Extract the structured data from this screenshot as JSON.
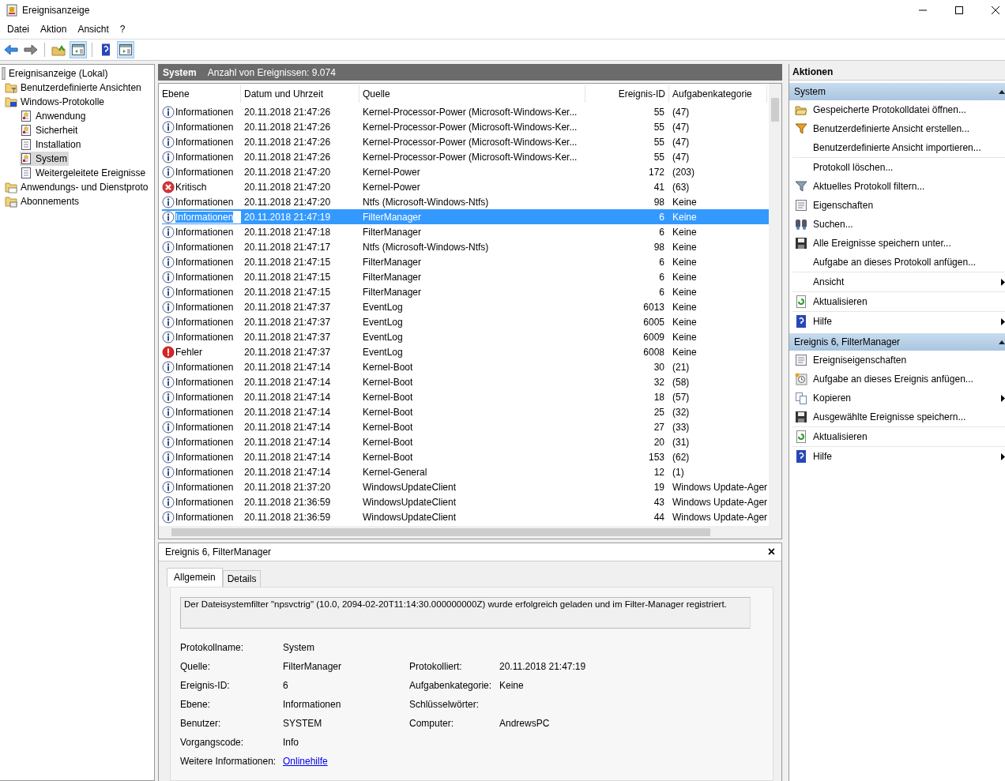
{
  "window": {
    "title": "Ereignisanzeige"
  },
  "menu": [
    "Datei",
    "Aktion",
    "Ansicht",
    "?"
  ],
  "toolbar": [
    {
      "kind": "back",
      "pressed": false
    },
    {
      "kind": "forward",
      "pressed": false
    },
    {
      "kind": "sep"
    },
    {
      "kind": "folder-up",
      "pressed": false
    },
    {
      "kind": "pane-left",
      "pressed": true
    },
    {
      "kind": "sep"
    },
    {
      "kind": "help",
      "pressed": false
    },
    {
      "kind": "pane-right",
      "pressed": true
    }
  ],
  "tree": [
    {
      "label": "Ereignisanzeige (Lokal)",
      "kind": "root",
      "selected": false,
      "children": [
        {
          "label": "Benutzerdefinierte Ansichten",
          "kind": "folder-filter",
          "selected": false
        },
        {
          "label": "Windows-Protokolle",
          "kind": "folder-windows",
          "selected": false,
          "children": [
            {
              "label": "Anwendung",
              "kind": "log",
              "selected": false
            },
            {
              "label": "Sicherheit",
              "kind": "log",
              "selected": false
            },
            {
              "label": "Installation",
              "kind": "log-plain",
              "selected": false
            },
            {
              "label": "System",
              "kind": "log",
              "selected": true
            },
            {
              "label": "Weitergeleitete Ereignisse",
              "kind": "log-plain",
              "selected": false
            }
          ]
        },
        {
          "label": "Anwendungs- und Dienstproto",
          "kind": "folder",
          "selected": false
        },
        {
          "label": "Abonnements",
          "kind": "folder-sub",
          "selected": false
        }
      ]
    }
  ],
  "log_header": {
    "name": "System",
    "count": "Anzahl von Ereignissen: 9.074"
  },
  "table": {
    "columns": [
      "Ebene",
      "Datum und Uhrzeit",
      "Quelle",
      "Ereignis-ID",
      "Aufgabenkategorie"
    ],
    "rows": [
      {
        "kind": "info",
        "level": "Informationen",
        "date": "20.11.2018 21:47:26",
        "source": "Kernel-Processor-Power (Microsoft-Windows-Ker...",
        "id": "55",
        "category": "(47)",
        "selected": false
      },
      {
        "kind": "info",
        "level": "Informationen",
        "date": "20.11.2018 21:47:26",
        "source": "Kernel-Processor-Power (Microsoft-Windows-Ker...",
        "id": "55",
        "category": "(47)",
        "selected": false
      },
      {
        "kind": "info",
        "level": "Informationen",
        "date": "20.11.2018 21:47:26",
        "source": "Kernel-Processor-Power (Microsoft-Windows-Ker...",
        "id": "55",
        "category": "(47)",
        "selected": false
      },
      {
        "kind": "info",
        "level": "Informationen",
        "date": "20.11.2018 21:47:26",
        "source": "Kernel-Processor-Power (Microsoft-Windows-Ker...",
        "id": "55",
        "category": "(47)",
        "selected": false
      },
      {
        "kind": "info",
        "level": "Informationen",
        "date": "20.11.2018 21:47:20",
        "source": "Kernel-Power",
        "id": "172",
        "category": "(203)",
        "selected": false
      },
      {
        "kind": "critical",
        "level": "Kritisch",
        "date": "20.11.2018 21:47:20",
        "source": "Kernel-Power",
        "id": "41",
        "category": "(63)",
        "selected": false
      },
      {
        "kind": "info",
        "level": "Informationen",
        "date": "20.11.2018 21:47:20",
        "source": "Ntfs (Microsoft-Windows-Ntfs)",
        "id": "98",
        "category": "Keine",
        "selected": false
      },
      {
        "kind": "info",
        "level": "Informationen",
        "date": "20.11.2018 21:47:19",
        "source": "FilterManager",
        "id": "6",
        "category": "Keine",
        "selected": true
      },
      {
        "kind": "info",
        "level": "Informationen",
        "date": "20.11.2018 21:47:18",
        "source": "FilterManager",
        "id": "6",
        "category": "Keine",
        "selected": false
      },
      {
        "kind": "info",
        "level": "Informationen",
        "date": "20.11.2018 21:47:17",
        "source": "Ntfs (Microsoft-Windows-Ntfs)",
        "id": "98",
        "category": "Keine",
        "selected": false
      },
      {
        "kind": "info",
        "level": "Informationen",
        "date": "20.11.2018 21:47:15",
        "source": "FilterManager",
        "id": "6",
        "category": "Keine",
        "selected": false
      },
      {
        "kind": "info",
        "level": "Informationen",
        "date": "20.11.2018 21:47:15",
        "source": "FilterManager",
        "id": "6",
        "category": "Keine",
        "selected": false
      },
      {
        "kind": "info",
        "level": "Informationen",
        "date": "20.11.2018 21:47:15",
        "source": "FilterManager",
        "id": "6",
        "category": "Keine",
        "selected": false
      },
      {
        "kind": "info",
        "level": "Informationen",
        "date": "20.11.2018 21:47:37",
        "source": "EventLog",
        "id": "6013",
        "category": "Keine",
        "selected": false
      },
      {
        "kind": "info",
        "level": "Informationen",
        "date": "20.11.2018 21:47:37",
        "source": "EventLog",
        "id": "6005",
        "category": "Keine",
        "selected": false
      },
      {
        "kind": "info",
        "level": "Informationen",
        "date": "20.11.2018 21:47:37",
        "source": "EventLog",
        "id": "6009",
        "category": "Keine",
        "selected": false
      },
      {
        "kind": "error",
        "level": "Fehler",
        "date": "20.11.2018 21:47:37",
        "source": "EventLog",
        "id": "6008",
        "category": "Keine",
        "selected": false
      },
      {
        "kind": "info",
        "level": "Informationen",
        "date": "20.11.2018 21:47:14",
        "source": "Kernel-Boot",
        "id": "30",
        "category": "(21)",
        "selected": false
      },
      {
        "kind": "info",
        "level": "Informationen",
        "date": "20.11.2018 21:47:14",
        "source": "Kernel-Boot",
        "id": "32",
        "category": "(58)",
        "selected": false
      },
      {
        "kind": "info",
        "level": "Informationen",
        "date": "20.11.2018 21:47:14",
        "source": "Kernel-Boot",
        "id": "18",
        "category": "(57)",
        "selected": false
      },
      {
        "kind": "info",
        "level": "Informationen",
        "date": "20.11.2018 21:47:14",
        "source": "Kernel-Boot",
        "id": "25",
        "category": "(32)",
        "selected": false
      },
      {
        "kind": "info",
        "level": "Informationen",
        "date": "20.11.2018 21:47:14",
        "source": "Kernel-Boot",
        "id": "27",
        "category": "(33)",
        "selected": false
      },
      {
        "kind": "info",
        "level": "Informationen",
        "date": "20.11.2018 21:47:14",
        "source": "Kernel-Boot",
        "id": "20",
        "category": "(31)",
        "selected": false
      },
      {
        "kind": "info",
        "level": "Informationen",
        "date": "20.11.2018 21:47:14",
        "source": "Kernel-Boot",
        "id": "153",
        "category": "(62)",
        "selected": false
      },
      {
        "kind": "info",
        "level": "Informationen",
        "date": "20.11.2018 21:47:14",
        "source": "Kernel-General",
        "id": "12",
        "category": "(1)",
        "selected": false
      },
      {
        "kind": "info",
        "level": "Informationen",
        "date": "20.11.2018 21:37:20",
        "source": "WindowsUpdateClient",
        "id": "19",
        "category": "Windows Update-Ager",
        "selected": false
      },
      {
        "kind": "info",
        "level": "Informationen",
        "date": "20.11.2018 21:36:59",
        "source": "WindowsUpdateClient",
        "id": "43",
        "category": "Windows Update-Ager",
        "selected": false
      },
      {
        "kind": "info",
        "level": "Informationen",
        "date": "20.11.2018 21:36:59",
        "source": "WindowsUpdateClient",
        "id": "44",
        "category": "Windows Update-Ager",
        "selected": false
      }
    ]
  },
  "detail": {
    "title": "Ereignis 6, FilterManager",
    "close": "×",
    "tabs": [
      {
        "label": "Allgemein",
        "selected": true
      },
      {
        "label": "Details",
        "selected": false
      }
    ],
    "message": "Der Dateisystemfilter \"npsvctrig\" (10.0, 2094-02-20T11:14:30.000000000Z) wurde erfolgreich geladen und im Filter-Manager registriert.",
    "fields": [
      [
        {
          "label": "Protokollname:",
          "value": "System"
        }
      ],
      [
        {
          "label": "Quelle:",
          "value": "FilterManager"
        },
        {
          "label": "Protokolliert:",
          "value": "20.11.2018 21:47:19"
        }
      ],
      [
        {
          "label": "Ereignis-ID:",
          "value": "6"
        },
        {
          "label": "Aufgabenkategorie:",
          "value": "Keine"
        }
      ],
      [
        {
          "label": "Ebene:",
          "value": "Informationen"
        },
        {
          "label": "Schlüsselwörter:"
        }
      ],
      [
        {
          "label": "Benutzer:",
          "value": "SYSTEM"
        },
        {
          "label": "Computer:",
          "value": "AndrewsPC"
        }
      ],
      [
        {
          "label": "Vorgangscode:",
          "value": "Info"
        }
      ],
      [
        {
          "label": "Weitere Informationen:",
          "value": "Onlinehilfe",
          "kind": "link"
        }
      ]
    ]
  },
  "actions": {
    "title": "Aktionen",
    "sections": [
      {
        "title": "System",
        "items": [
          {
            "label": "Gespeicherte Protokolldatei öffnen...",
            "kind": "folder-open"
          },
          {
            "label": "Benutzerdefinierte Ansicht erstellen...",
            "kind": "funnel-star"
          },
          {
            "label": "Benutzerdefinierte Ansicht importieren...",
            "divider": true
          },
          {
            "label": "Protokoll löschen..."
          },
          {
            "label": "Aktuelles Protokoll filtern...",
            "kind": "funnel"
          },
          {
            "label": "Eigenschaften",
            "kind": "properties"
          },
          {
            "label": "Suchen...",
            "kind": "binoculars"
          },
          {
            "label": "Alle Ereignisse speichern unter...",
            "kind": "floppy"
          },
          {
            "label": "Aufgabe an dieses Protokoll anfügen...",
            "divider": true
          },
          {
            "label": "Ansicht",
            "submenu": true,
            "divider": true
          },
          {
            "label": "Aktualisieren",
            "kind": "refresh",
            "divider": true
          },
          {
            "label": "Hilfe",
            "kind": "help",
            "submenu": true
          }
        ]
      },
      {
        "title": "Ereignis 6, FilterManager",
        "items": [
          {
            "label": "Ereigniseigenschaften",
            "kind": "properties"
          },
          {
            "label": "Aufgabe an dieses Ereignis anfügen...",
            "kind": "clock"
          },
          {
            "label": "Kopieren",
            "kind": "copy",
            "submenu": true
          },
          {
            "label": "Ausgewählte Ereignisse speichern...",
            "kind": "floppy",
            "divider": true
          },
          {
            "label": "Aktualisieren",
            "kind": "refresh",
            "divider": true
          },
          {
            "label": "Hilfe",
            "kind": "help",
            "submenu": true
          }
        ]
      }
    ]
  }
}
